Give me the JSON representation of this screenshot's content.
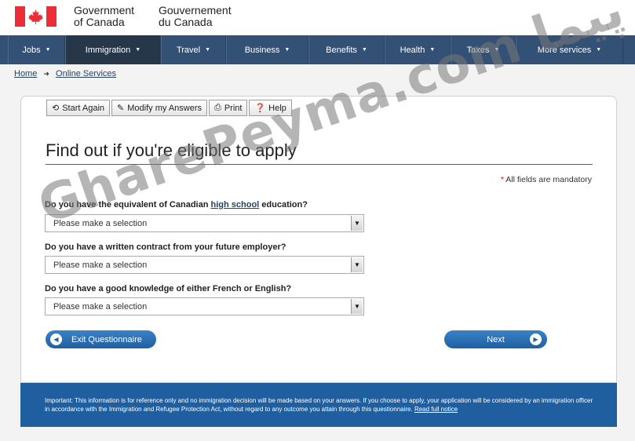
{
  "header": {
    "wordmark_en_line1": "Government",
    "wordmark_en_line2": "of Canada",
    "wordmark_fr_line1": "Gouvernement",
    "wordmark_fr_line2": "du Canada"
  },
  "nav": {
    "items": [
      {
        "label": "Jobs"
      },
      {
        "label": "Immigration"
      },
      {
        "label": "Travel"
      },
      {
        "label": "Business"
      },
      {
        "label": "Benefits"
      },
      {
        "label": "Health"
      },
      {
        "label": "Taxes"
      },
      {
        "label": "More services"
      }
    ],
    "active": "Immigration"
  },
  "breadcrumb": {
    "home": "Home",
    "current": "Online Services"
  },
  "toolbar": {
    "start_again": "Start Again",
    "modify": "Modify my Answers",
    "print": "Print",
    "help": "Help"
  },
  "form": {
    "title": "Find out if you're eligible to apply",
    "mandatory_star": "*",
    "mandatory_text": "All fields are mandatory",
    "q1_prefix": "Do you have the equivalent of Canadian",
    "q1_link": "high school",
    "q1_suffix": "education?",
    "q2": "Do you have a written contract from your future employer?",
    "q3": "Do you have a good knowledge of either French or English?",
    "select_placeholder": "Please make a selection",
    "exit_label": "Exit Questionnaire",
    "next_label": "Next"
  },
  "notice": {
    "label": "Important:",
    "text": "This information is for reference only and no immigration decision will be made based on your answers. If you choose to apply, your application will be considered by an immigration officer in accordance with the Immigration and Refugee Protection Act, without regard to any outcome you attain through this questionnaire.",
    "link": "Read full notice"
  },
  "watermark": {
    "latin": "GharePeyma.com",
    "persian": "قاره پیما"
  },
  "colors": {
    "nav_bg": "#335075",
    "nav_active": "#26374a",
    "flag_red": "#eb2d37",
    "title_rule": "#af3c43",
    "button_blue": "#1f5fa0",
    "notice_bg": "#1f5fa0"
  },
  "icons": {
    "start_again": "refresh-icon",
    "modify": "pencil-icon",
    "print": "printer-icon",
    "help": "question-circle-icon",
    "exit": "arrow-left-circle-icon",
    "next": "arrow-right-circle-icon"
  }
}
